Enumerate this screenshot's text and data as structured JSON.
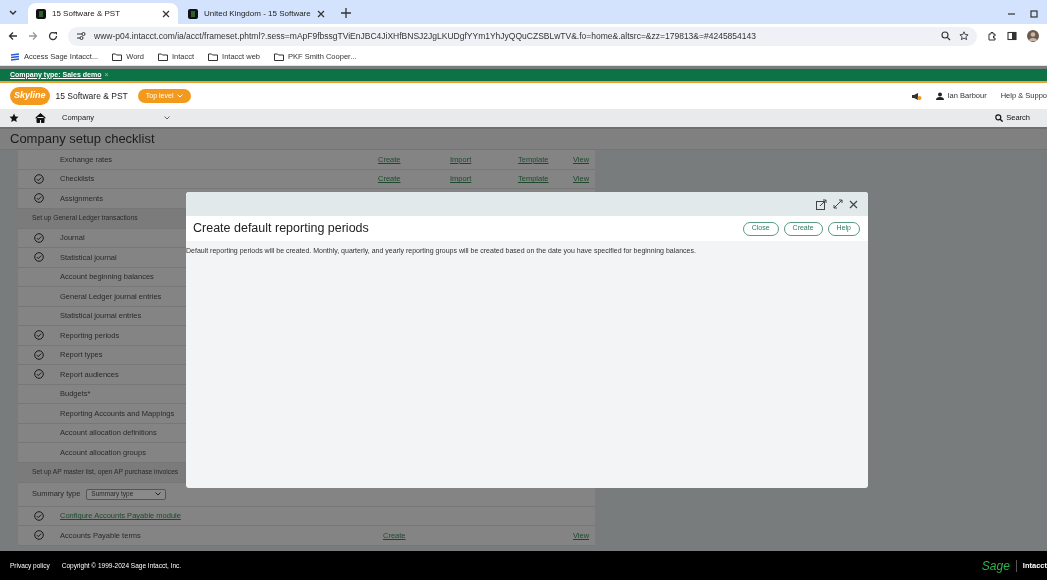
{
  "browser": {
    "tabs": [
      {
        "title": "15 Software & PST",
        "selected": true
      },
      {
        "title": "United Kingdom - 15 Software",
        "selected": false
      }
    ],
    "url": "www-p04.intacct.com/ia/acct/frameset.phtml?.sess=mApF9fbssgTViEnJBC4JiXHfBNSJ2JgLKUDgfYYm1YhJyQQuCZSBLwTV&.fo=home&.altsrc=&zz=179813&=#4245854143",
    "bookmarks": [
      {
        "label": "Access Sage Intacct...",
        "kind": "site"
      },
      {
        "label": "Word",
        "kind": "folder"
      },
      {
        "label": "Intacct",
        "kind": "folder"
      },
      {
        "label": "Intacct web",
        "kind": "folder"
      },
      {
        "label": "PKF Smith Cooper...",
        "kind": "folder"
      }
    ]
  },
  "banner": {
    "text": "Company type: Sales demo",
    "close": "×"
  },
  "app_header": {
    "logo": "Skyline",
    "company": "15 Software & PST",
    "level_button": "Top level",
    "user": "Ian Barbour",
    "help": "Help & Suppo"
  },
  "nav": {
    "menu": "Company",
    "search": "Search"
  },
  "page": {
    "title": "Company setup checklist",
    "rows": [
      {
        "kind": "item",
        "label": "Exchange rates",
        "checked": false,
        "actions": [
          "Create",
          "Import",
          "Template",
          "View"
        ]
      },
      {
        "kind": "item",
        "label": "Checklists",
        "checked": true,
        "actions": [
          "Create",
          "Import",
          "Template",
          "View"
        ]
      },
      {
        "kind": "item",
        "label": "Assignments",
        "checked": true
      },
      {
        "kind": "section",
        "label": "Set up General Ledger transactions"
      },
      {
        "kind": "item",
        "label": "Journal",
        "checked": true
      },
      {
        "kind": "item",
        "label": "Statistical journal",
        "checked": true
      },
      {
        "kind": "item",
        "label": "Account beginning balances",
        "checked": false
      },
      {
        "kind": "item",
        "label": "General Ledger journal entries",
        "checked": false
      },
      {
        "kind": "item",
        "label": "Statistical journal entries",
        "checked": false
      },
      {
        "kind": "item",
        "label": "Reporting periods",
        "checked": true
      },
      {
        "kind": "item",
        "label": "Report types",
        "checked": true
      },
      {
        "kind": "item",
        "label": "Report audiences",
        "checked": true
      },
      {
        "kind": "item",
        "label": "Budgets*",
        "checked": false
      },
      {
        "kind": "item",
        "label": "Reporting Accounts and Mappings",
        "checked": false
      },
      {
        "kind": "item",
        "label": "Account allocation definitions",
        "checked": false
      },
      {
        "kind": "item",
        "label": "Account allocation groups",
        "checked": false
      },
      {
        "kind": "section",
        "label": "Set up AP master list, open AP purchase invoices"
      },
      {
        "kind": "summary",
        "label": "Summary type",
        "value": "Summary type"
      },
      {
        "kind": "link",
        "label": "Configure Accounts Payable module",
        "checked": true
      },
      {
        "kind": "item",
        "label": "Accounts Payable terms",
        "checked": true,
        "actions": [
          "Create",
          "View"
        ]
      }
    ]
  },
  "modal": {
    "title": "Create default reporting periods",
    "buttons": [
      "Close",
      "Create",
      "Help"
    ],
    "message": "Default reporting periods will be created. Monthly, quarterly, and yearly reporting groups will be created based on the date you have specified for beginning balances."
  },
  "footer": {
    "links": [
      "Privacy policy"
    ],
    "copyright": "Copyright © 1999-2024 Sage Intacct, Inc.",
    "brand": "Sage",
    "product": "Intacct"
  }
}
